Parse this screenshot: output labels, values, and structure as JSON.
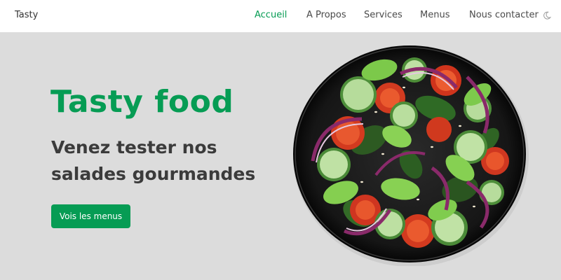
{
  "header": {
    "logo": "Tasty",
    "nav": [
      {
        "label": "Accueil",
        "active": true
      },
      {
        "label": "A Propos",
        "active": false
      },
      {
        "label": "Services",
        "active": false
      },
      {
        "label": "Menus",
        "active": false
      },
      {
        "label": "Nous contacter",
        "active": false
      }
    ],
    "theme_toggle_icon": "moon-icon"
  },
  "hero": {
    "title": "Tasty food",
    "subtitle": "Venez tester nos salades gourmandes",
    "button_label": "Vois les menus",
    "image_icon": "salad-plate-image"
  },
  "colors": {
    "accent": "#069c54",
    "background": "#dcdcdc",
    "header_background": "#ffffff",
    "text_dark": "#3b3b3b"
  }
}
